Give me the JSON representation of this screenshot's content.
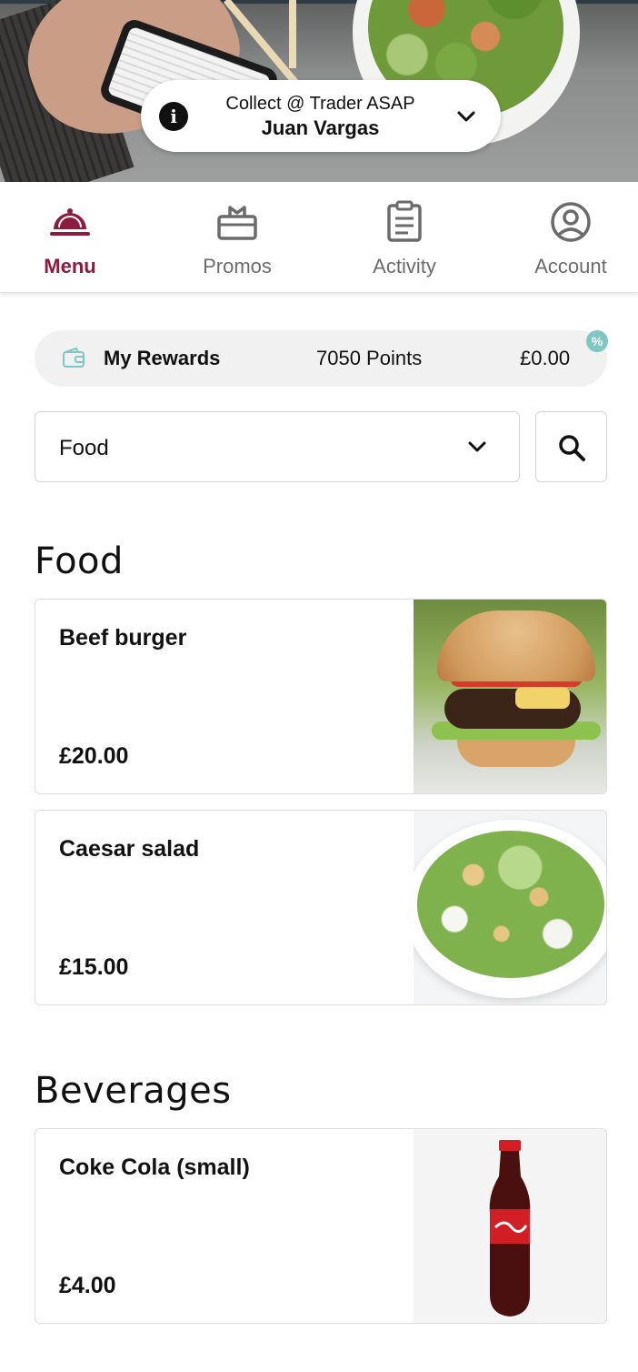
{
  "collect": {
    "line1": "Collect @ Trader  ASAP",
    "line2": "Juan Vargas"
  },
  "nav": {
    "items": [
      {
        "label": "Menu",
        "icon": "cloche-icon",
        "active": true
      },
      {
        "label": "Promos",
        "icon": "gift-icon",
        "active": false
      },
      {
        "label": "Activity",
        "icon": "clipboard-icon",
        "active": false
      },
      {
        "label": "Account",
        "icon": "user-circle-icon",
        "active": false
      }
    ]
  },
  "rewards": {
    "title": "My Rewards",
    "points": "7050 Points",
    "balance": "£0.00",
    "badge": "%",
    "icon": "wallet-icon"
  },
  "filter": {
    "category": "Food",
    "icon": "chevron-down-icon",
    "search_icon": "search-icon"
  },
  "sections": [
    {
      "title": "Food",
      "items": [
        {
          "name": "Beef burger",
          "price": "£20.00",
          "image": "burger"
        },
        {
          "name": "Caesar salad",
          "price": "£15.00",
          "image": "salad"
        }
      ]
    },
    {
      "title": "Beverages",
      "items": [
        {
          "name": "Coke Cola (small)",
          "price": "£4.00",
          "image": "coke"
        }
      ]
    }
  ],
  "colors": {
    "accent": "#8d1b3d",
    "nav_inactive": "#6b6b6b",
    "badge": "#7fc7c2",
    "rewards_bg": "#f1f1f1"
  }
}
